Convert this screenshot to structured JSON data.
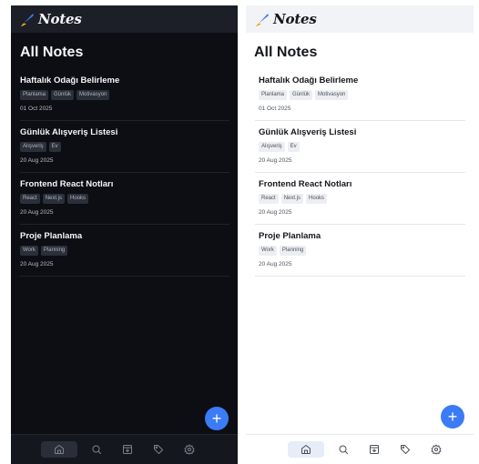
{
  "app": {
    "brand": "Notes",
    "page_title": "All Notes",
    "accent_color": "#3b7bf5",
    "logo_icon": "feather-pen-icon"
  },
  "notes": [
    {
      "title": "Haftalık Odağı Belirleme",
      "tags": [
        "Planlama",
        "Günlük",
        "Motivasyon"
      ],
      "date": "01 Oct 2025"
    },
    {
      "title": "Günlük Alışveriş Listesi",
      "tags": [
        "Alışveriş",
        "Ev"
      ],
      "date": "20 Aug 2025"
    },
    {
      "title": "Frontend React Notları",
      "tags": [
        "React",
        "Next.js",
        "Hooks"
      ],
      "date": "20 Aug 2025"
    },
    {
      "title": "Proje Planlama",
      "tags": [
        "Work",
        "Planning"
      ],
      "date": "20 Aug 2025"
    }
  ],
  "fab": {
    "label": "+",
    "icon": "plus-icon"
  },
  "bottom_nav": [
    {
      "icon": "home-icon",
      "active": true
    },
    {
      "icon": "search-icon",
      "active": false
    },
    {
      "icon": "archive-icon",
      "active": false
    },
    {
      "icon": "tag-icon",
      "active": false
    },
    {
      "icon": "gear-icon",
      "active": false
    }
  ],
  "themes": [
    {
      "name": "dark",
      "background": "#0c0e14"
    },
    {
      "name": "light",
      "background": "#ffffff"
    }
  ]
}
